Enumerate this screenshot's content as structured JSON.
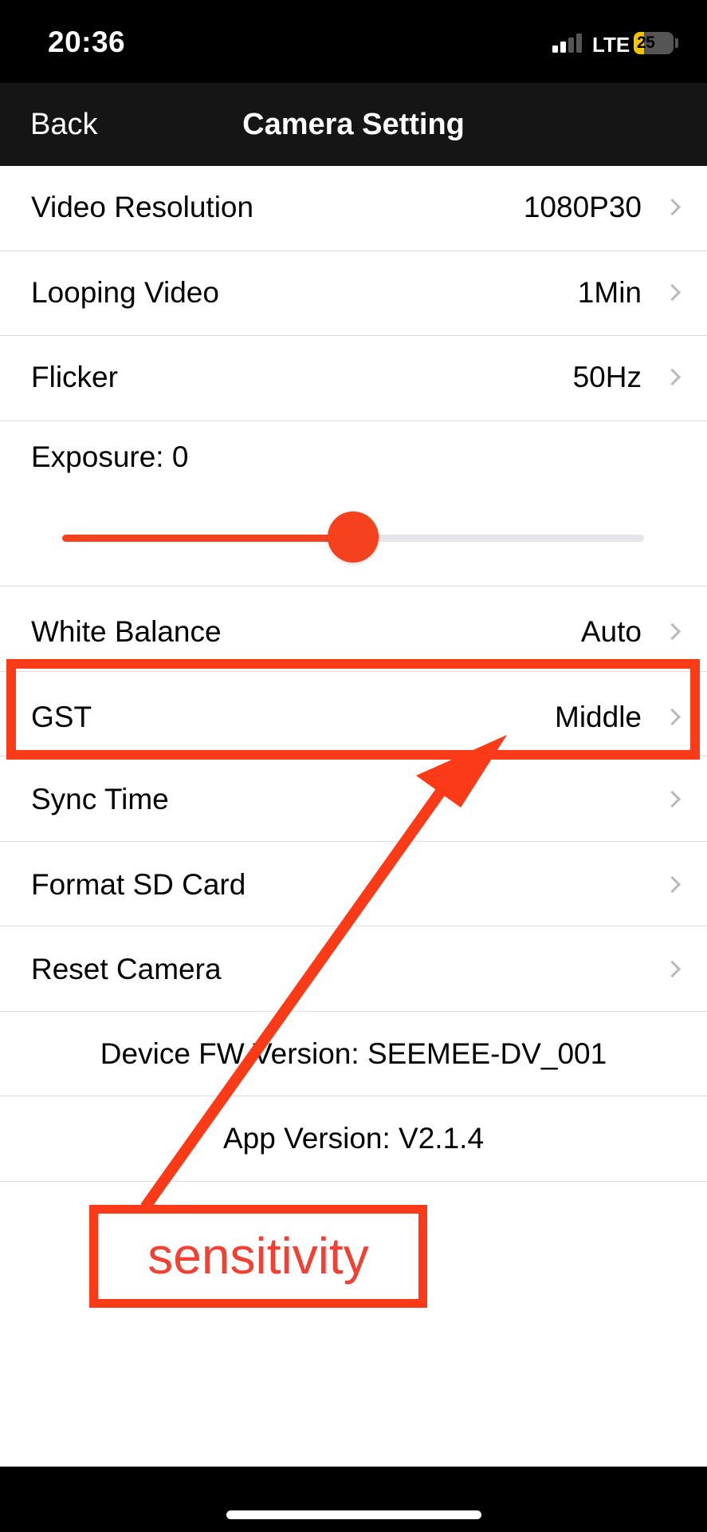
{
  "status_bar": {
    "time": "20:36",
    "network": "LTE",
    "battery_percent": "25",
    "battery_level": 0.25,
    "signal_bars": 2,
    "signal_bars_total": 4
  },
  "nav": {
    "back_label": "Back",
    "title": "Camera Setting"
  },
  "settings": {
    "video_resolution": {
      "label": "Video Resolution",
      "value": "1080P30"
    },
    "looping_video": {
      "label": "Looping Video",
      "value": "1Min"
    },
    "flicker": {
      "label": "Flicker",
      "value": "50Hz"
    },
    "exposure": {
      "label": "Exposure: 0",
      "slider_level": 0.5
    },
    "white_balance": {
      "label": "White Balance",
      "value": "Auto"
    },
    "gst": {
      "label": "GST",
      "value": "Middle"
    },
    "sync_time": {
      "label": "Sync Time"
    },
    "format_sd": {
      "label": "Format SD Card"
    },
    "reset_camera": {
      "label": "Reset Camera"
    }
  },
  "info": {
    "device_fw": "Device FW Version: SEEMEE-DV_001",
    "app_version": "App Version: V2.1.4"
  },
  "annotation": {
    "note": "sensitivity",
    "color": "#fb3b18"
  },
  "colors": {
    "accent": "#f5411d",
    "nav_background": "#151515",
    "chevron": "#b9b9bd"
  }
}
